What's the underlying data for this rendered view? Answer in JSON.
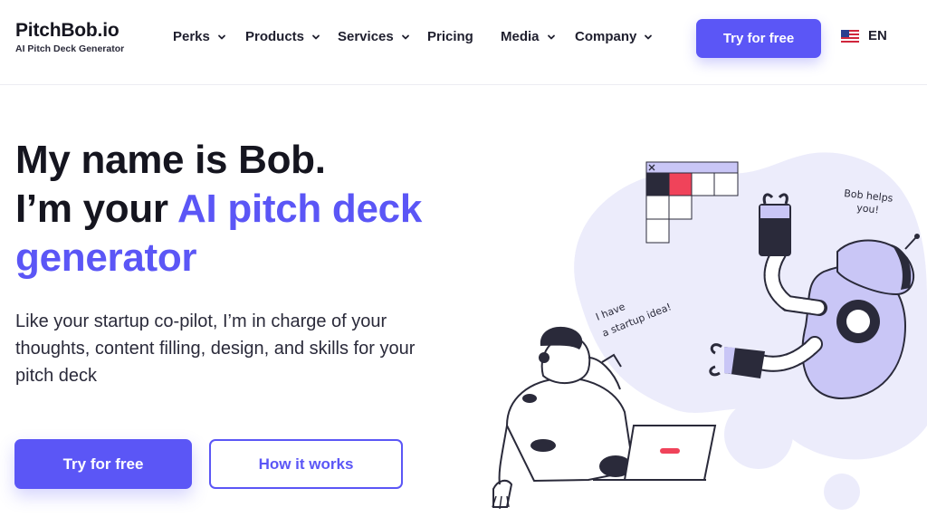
{
  "header": {
    "logo_title": "PitchBob.io",
    "logo_subtitle": "AI Pitch Deck Generator",
    "nav": [
      {
        "label": "Perks",
        "has_dropdown": true
      },
      {
        "label": "Products",
        "has_dropdown": true
      },
      {
        "label": "Services",
        "has_dropdown": true
      },
      {
        "label": "Pricing",
        "has_dropdown": false
      },
      {
        "label": "Media",
        "has_dropdown": true
      },
      {
        "label": "Company",
        "has_dropdown": true
      }
    ],
    "cta_label": "Try for free",
    "language": "EN",
    "language_icon": "us-flag-icon"
  },
  "hero": {
    "title_line1": "My name is Bob.",
    "title_line2_prefix": "I’m your ",
    "title_line2_accent": "AI pitch deck",
    "title_line3_accent": "generator",
    "description": "Like your startup co-pilot, I’m in charge of your thoughts, content filling, design, and skills for your pitch deck",
    "primary_button": "Try for free",
    "secondary_button": "How it works"
  },
  "illustration": {
    "bob_speech": [
      "Bob helps",
      "you!"
    ],
    "person_speech": [
      "I have",
      "a startup idea!"
    ]
  },
  "colors": {
    "accent": "#5b56f6",
    "text_dark": "#15151f",
    "blob": "#ececfb",
    "robot_body": "#c9c6f6",
    "red": "#f0435a"
  }
}
